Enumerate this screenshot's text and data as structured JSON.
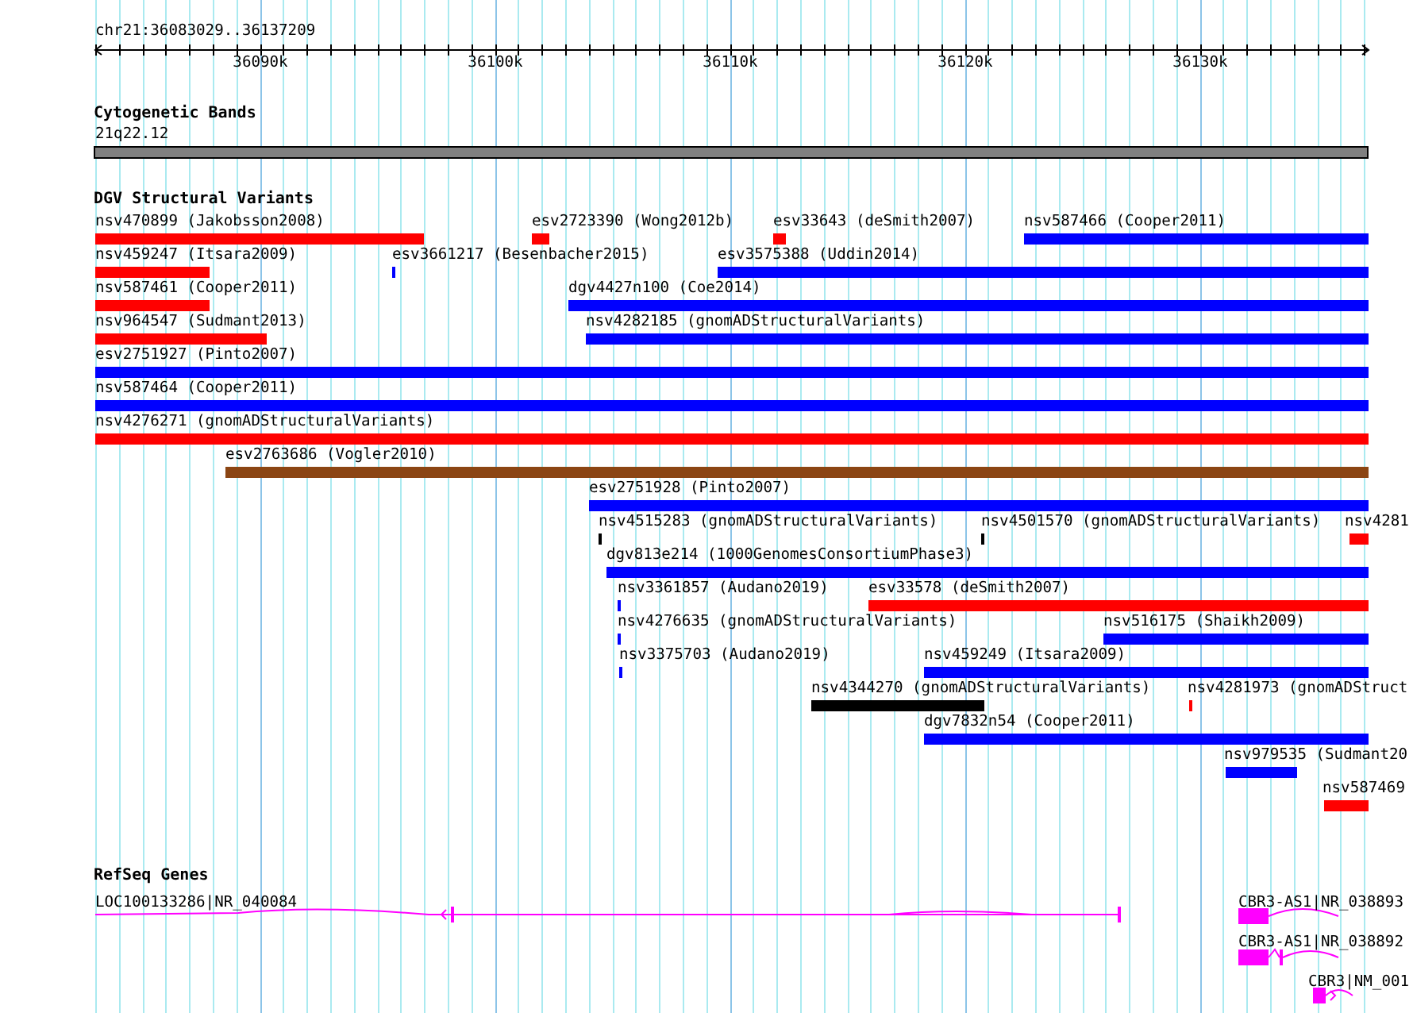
{
  "ruler": {
    "location": "chr21:36083029..36137209",
    "ticks": [
      "36090k",
      "36100k",
      "36110k",
      "36120k",
      "36130k"
    ]
  },
  "cytoband_track": {
    "title": "Cytogenetic Bands",
    "band": "21q22.12"
  },
  "variant_track": {
    "title": "DGV Structural Variants",
    "features": [
      {
        "label": "nsv470899 (Jakobsson2008)",
        "color": "#ff0000"
      },
      {
        "label": "esv2723390 (Wong2012b)",
        "color": "#ff0000"
      },
      {
        "label": "esv33643 (deSmith2007)",
        "color": "#ff0000"
      },
      {
        "label": "nsv587466 (Cooper2011)",
        "color": "#0000ff"
      },
      {
        "label": "nsv459247 (Itsara2009)",
        "color": "#ff0000"
      },
      {
        "label": "esv3661217 (Besenbacher2015)",
        "color": "#0000ff"
      },
      {
        "label": "esv3575388 (Uddin2014)",
        "color": "#0000ff"
      },
      {
        "label": "nsv587461 (Cooper2011)",
        "color": "#ff0000"
      },
      {
        "label": "dgv4427n100 (Coe2014)",
        "color": "#0000ff"
      },
      {
        "label": "nsv964547 (Sudmant2013)",
        "color": "#ff0000"
      },
      {
        "label": "nsv4282185 (gnomADStructuralVariants)",
        "color": "#0000ff"
      },
      {
        "label": "esv2751927 (Pinto2007)",
        "color": "#0000ff"
      },
      {
        "label": "nsv587464 (Cooper2011)",
        "color": "#0000ff"
      },
      {
        "label": "nsv4276271 (gnomADStructuralVariants)",
        "color": "#ff0000"
      },
      {
        "label": "esv2763686 (Vogler2010)",
        "color": "#8b4513"
      },
      {
        "label": "esv2751928 (Pinto2007)",
        "color": "#0000ff"
      },
      {
        "label": "nsv4515283 (gnomADStructuralVariants)",
        "color": "#000000"
      },
      {
        "label": "nsv4501570 (gnomADStructuralVariants)",
        "color": "#000000"
      },
      {
        "label": "nsv4281",
        "color": "#ff0000"
      },
      {
        "label": "dgv813e214 (1000GenomesConsortiumPhase3)",
        "color": "#0000ff"
      },
      {
        "label": "nsv3361857 (Audano2019)",
        "color": "#0000ff"
      },
      {
        "label": "esv33578 (deSmith2007)",
        "color": "#ff0000"
      },
      {
        "label": "nsv4276635 (gnomADStructuralVariants)",
        "color": "#0000ff"
      },
      {
        "label": "nsv516175 (Shaikh2009)",
        "color": "#0000ff"
      },
      {
        "label": "nsv3375703 (Audano2019)",
        "color": "#0000ff"
      },
      {
        "label": "nsv459249 (Itsara2009)",
        "color": "#0000ff"
      },
      {
        "label": "nsv4344270 (gnomADStructuralVariants)",
        "color": "#000000"
      },
      {
        "label": "nsv4281973 (gnomADStruct",
        "color": "#ff0000"
      },
      {
        "label": "dgv7832n54 (Cooper2011)",
        "color": "#0000ff"
      },
      {
        "label": "nsv979535 (Sudmant20",
        "color": "#0000ff"
      },
      {
        "label": "nsv587469",
        "color": "#ff0000"
      }
    ]
  },
  "gene_track": {
    "title": "RefSeq Genes",
    "genes": [
      {
        "label": "LOC100133286|NR_040084"
      },
      {
        "label": "CBR3-AS1|NR_038893"
      },
      {
        "label": "CBR3-AS1|NR_038892"
      },
      {
        "label": "CBR3|NM_001"
      }
    ]
  }
}
